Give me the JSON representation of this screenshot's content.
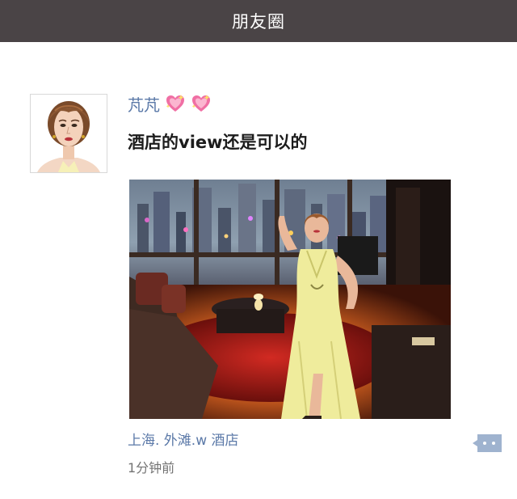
{
  "header": {
    "title": "朋友圈"
  },
  "post": {
    "username": "芃芃",
    "name_icons": [
      "sparkling-heart-icon",
      "sparkling-heart-icon"
    ],
    "text": "酒店的view还是可以的",
    "location": "上海. 外滩.w 酒店",
    "time": "1分钟前",
    "image": "hotel-room-photo-with-woman-in-yellow-dress",
    "avatar": "cartoon-woman-portrait"
  },
  "colors": {
    "header_bg": "#4a4446",
    "link_blue": "#5b79a8",
    "comment_button": "#9fb3cf"
  }
}
